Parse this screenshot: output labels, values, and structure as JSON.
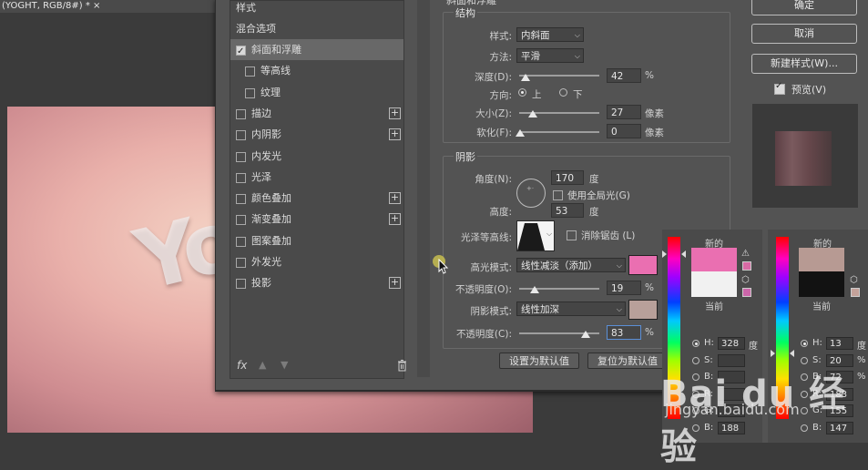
{
  "document": {
    "tab_title": "(YOGHT, RGB/8#) * ×",
    "canvas_text": "Yo"
  },
  "layer_style": {
    "header_partial": "斜面和浮雕",
    "styles_label": "样式",
    "blend_options_label": "混合选项",
    "effects": [
      {
        "label": "斜面和浮雕",
        "checked": true,
        "active": true,
        "has_plus": false,
        "indent": false
      },
      {
        "label": "等高线",
        "checked": false,
        "active": false,
        "has_plus": false,
        "indent": true
      },
      {
        "label": "纹理",
        "checked": false,
        "active": false,
        "has_plus": false,
        "indent": true
      },
      {
        "label": "描边",
        "checked": false,
        "active": false,
        "has_plus": true,
        "indent": false
      },
      {
        "label": "内阴影",
        "checked": false,
        "active": false,
        "has_plus": true,
        "indent": false
      },
      {
        "label": "内发光",
        "checked": false,
        "active": false,
        "has_plus": false,
        "indent": false
      },
      {
        "label": "光泽",
        "checked": false,
        "active": false,
        "has_plus": false,
        "indent": false
      },
      {
        "label": "颜色叠加",
        "checked": false,
        "active": false,
        "has_plus": true,
        "indent": false
      },
      {
        "label": "渐变叠加",
        "checked": false,
        "active": false,
        "has_plus": true,
        "indent": false
      },
      {
        "label": "图案叠加",
        "checked": false,
        "active": false,
        "has_plus": false,
        "indent": false
      },
      {
        "label": "外发光",
        "checked": false,
        "active": false,
        "has_plus": false,
        "indent": false
      },
      {
        "label": "投影",
        "checked": false,
        "active": false,
        "has_plus": true,
        "indent": false
      }
    ],
    "footer": {
      "fx_label": "fx"
    },
    "structure": {
      "title": "结构",
      "style_label": "样式:",
      "style_value": "内斜面",
      "technique_label": "方法:",
      "technique_value": "平滑",
      "depth_label": "深度(D):",
      "depth_value": "42",
      "depth_unit": "%",
      "direction_label": "方向:",
      "dir_up": "上",
      "dir_down": "下",
      "size_label": "大小(Z):",
      "size_value": "27",
      "size_unit": "像素",
      "soften_label": "软化(F):",
      "soften_value": "0",
      "soften_unit": "像素"
    },
    "shading": {
      "title": "阴影",
      "angle_label": "角度(N):",
      "angle_value": "170",
      "angle_unit": "度",
      "global_light_label": "使用全局光(G)",
      "altitude_label": "高度:",
      "altitude_value": "53",
      "altitude_unit": "度",
      "gloss_label": "光泽等高线:",
      "antialias_label": "消除锯齿 (L)",
      "highlight_mode_label": "高光模式:",
      "highlight_mode_value": "线性减淡（添加）",
      "highlight_color": "#ea6fb1",
      "highlight_opacity_label": "不透明度(O):",
      "highlight_opacity_value": "19",
      "highlight_opacity_unit": "%",
      "shadow_mode_label": "阴影模式:",
      "shadow_mode_value": "线性加深",
      "shadow_color": "#b8a09a",
      "shadow_opacity_label": "不透明度(C):",
      "shadow_opacity_value": "83",
      "shadow_opacity_unit": "%"
    },
    "buttons": {
      "make_default": "设置为默认值",
      "reset_default": "复位为默认值"
    }
  },
  "side_buttons": {
    "ok": "确定",
    "cancel": "取消",
    "new_style": "新建样式(W)...",
    "preview": "预览(V)"
  },
  "color_pickers": [
    {
      "new_label": "新的",
      "current_label": "当前",
      "new_color": "#ea6fb1",
      "current_color": "#f1f1f1",
      "fields": [
        {
          "label": "H:",
          "value": "328",
          "unit": "度",
          "selected": true
        },
        {
          "label": "S:",
          "value": "",
          "unit": "",
          "selected": false
        },
        {
          "label": "B:",
          "value": "",
          "unit": "",
          "selected": false
        },
        {
          "label": "R:",
          "value": "",
          "unit": "",
          "selected": false
        },
        {
          "label": "G:",
          "value": "",
          "unit": "",
          "selected": false
        },
        {
          "label": "B:",
          "value": "188",
          "unit": "",
          "selected": false
        }
      ]
    },
    {
      "new_label": "新的",
      "current_label": "当前",
      "new_color": "#b79a93",
      "current_color": "#121212",
      "fields": [
        {
          "label": "H:",
          "value": "13",
          "unit": "度",
          "selected": true
        },
        {
          "label": "S:",
          "value": "20",
          "unit": "%",
          "selected": false
        },
        {
          "label": "B:",
          "value": "72",
          "unit": "%",
          "selected": false
        },
        {
          "label": "R:",
          "value": "183",
          "unit": "",
          "selected": false
        },
        {
          "label": "G:",
          "value": "155",
          "unit": "",
          "selected": false
        },
        {
          "label": "B:",
          "value": "147",
          "unit": "",
          "selected": false
        }
      ]
    }
  ],
  "watermark": {
    "brand": "Bai du 经验",
    "url": "jingyan.baidu.com"
  }
}
